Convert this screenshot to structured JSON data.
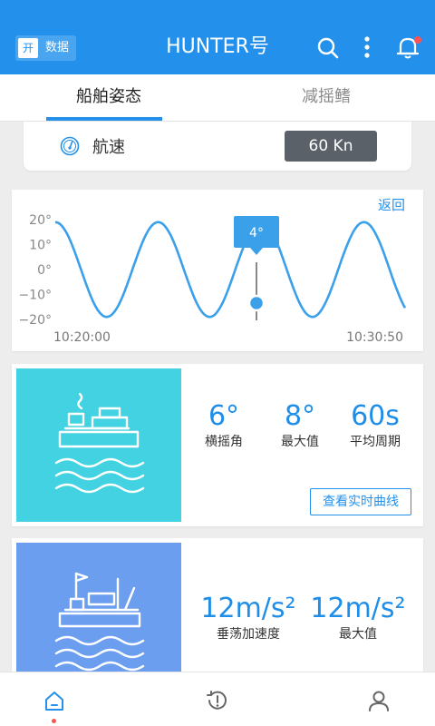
{
  "header": {
    "toggle_on": "开",
    "toggle_label": "数据",
    "title": "HUNTER号",
    "bg_color": "#2391eb"
  },
  "tabs": [
    {
      "label": "船舶姿态",
      "active": true
    },
    {
      "label": "减摇鳍",
      "active": false
    }
  ],
  "speed": {
    "label": "航速",
    "value": "60 Kn",
    "icon": "speedometer-icon"
  },
  "chart": {
    "back_label": "返回",
    "tooltip": "4°"
  },
  "chart_data": {
    "type": "line",
    "y_ticks": [
      "20°",
      "10°",
      "0°",
      "−10°",
      "−20°"
    ],
    "ylim": [
      -20,
      20
    ],
    "x_tick_labels": [
      "10:20:00",
      "10:30:50"
    ],
    "series": [
      {
        "color": "#3aa0ea",
        "amplitude": 19,
        "cycles": 3.4,
        "phase": 0.5
      }
    ],
    "cursor_value": 4,
    "grid": false
  },
  "roll": {
    "tile_color": "#43d2e1",
    "icon": "ship-waves-icon",
    "stats": [
      {
        "value": "6°",
        "label": "横摇角"
      },
      {
        "value": "8°",
        "label": "最大值"
      },
      {
        "value": "60s",
        "label": "平均周期"
      }
    ],
    "button_label": "查看实时曲线"
  },
  "heave": {
    "tile_color": "#6c9ef0",
    "icon": "platform-waves-icon",
    "stats": [
      {
        "value": "12m/s²",
        "label": "垂荡加速度"
      },
      {
        "value": "12m/s²",
        "label": "最大值"
      }
    ]
  },
  "bottom_nav": [
    {
      "icon": "home-icon",
      "active": true
    },
    {
      "icon": "alert-history-icon",
      "active": false
    },
    {
      "icon": "user-icon",
      "active": false
    }
  ]
}
